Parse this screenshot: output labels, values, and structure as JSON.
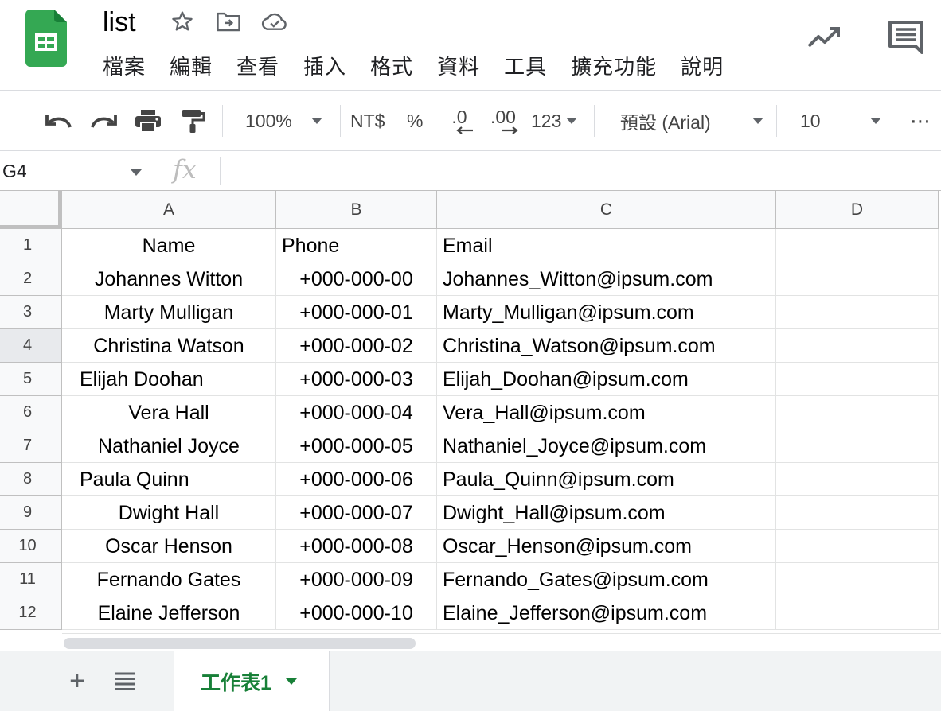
{
  "app": {
    "title": "list",
    "menu": [
      "檔案",
      "編輯",
      "查看",
      "插入",
      "格式",
      "資料",
      "工具",
      "擴充功能",
      "說明"
    ]
  },
  "toolbar": {
    "zoom": "100%",
    "currency": "NT$",
    "percent": "%",
    "decrease_decimal": ".0",
    "increase_decimal": ".00",
    "more_formats": "123",
    "font": "預設 (Arial)",
    "font_size": "10",
    "more": "⋯"
  },
  "formula_bar": {
    "cell_ref": "G4",
    "fx": "fx",
    "value": ""
  },
  "grid": {
    "columns": [
      "A",
      "B",
      "C",
      "D"
    ],
    "selected_row": 4,
    "rows": [
      {
        "n": "1",
        "a": "Name",
        "b": "Phone",
        "c": "Email"
      },
      {
        "n": "2",
        "a": "Johannes Witton",
        "b": "+000-000-00",
        "c": "Johannes_Witton@ipsum.com"
      },
      {
        "n": "3",
        "a": "Marty Mulligan",
        "b": "+000-000-01",
        "c": "Marty_Mulligan@ipsum.com"
      },
      {
        "n": "4",
        "a": "Christina Watson",
        "b": "+000-000-02",
        "c": "Christina_Watson@ipsum.com"
      },
      {
        "n": "5",
        "a": "Elijah Doohan",
        "b": "+000-000-03",
        "c": "Elijah_Doohan@ipsum.com"
      },
      {
        "n": "6",
        "a": "Vera Hall",
        "b": "+000-000-04",
        "c": "Vera_Hall@ipsum.com"
      },
      {
        "n": "7",
        "a": "Nathaniel Joyce",
        "b": "+000-000-05",
        "c": "Nathaniel_Joyce@ipsum.com"
      },
      {
        "n": "8",
        "a": "Paula Quinn",
        "b": "+000-000-06",
        "c": "Paula_Quinn@ipsum.com"
      },
      {
        "n": "9",
        "a": "Dwight Hall",
        "b": "+000-000-07",
        "c": "Dwight_Hall@ipsum.com"
      },
      {
        "n": "10",
        "a": "Oscar Henson",
        "b": "+000-000-08",
        "c": "Oscar_Henson@ipsum.com"
      },
      {
        "n": "11",
        "a": "Fernando Gates",
        "b": "+000-000-09",
        "c": "Fernando_Gates@ipsum.com"
      },
      {
        "n": "12",
        "a": "Elaine Jefferson",
        "b": "+000-000-10",
        "c": "Elaine_Jefferson@ipsum.com"
      }
    ]
  },
  "sheets": {
    "add": "+",
    "active": "工作表1"
  },
  "icons": {
    "logo": "sheets-logo-icon",
    "star": "star-icon",
    "move": "move-to-folder-icon",
    "cloud": "cloud-saved-icon",
    "trend": "activity-trend-icon",
    "comment": "comment-icon",
    "undo": "undo-icon",
    "redo": "redo-icon",
    "print": "print-icon",
    "paint": "paint-format-icon"
  },
  "colors": {
    "brand_green": "#188038",
    "logo_green": "#34a853"
  }
}
